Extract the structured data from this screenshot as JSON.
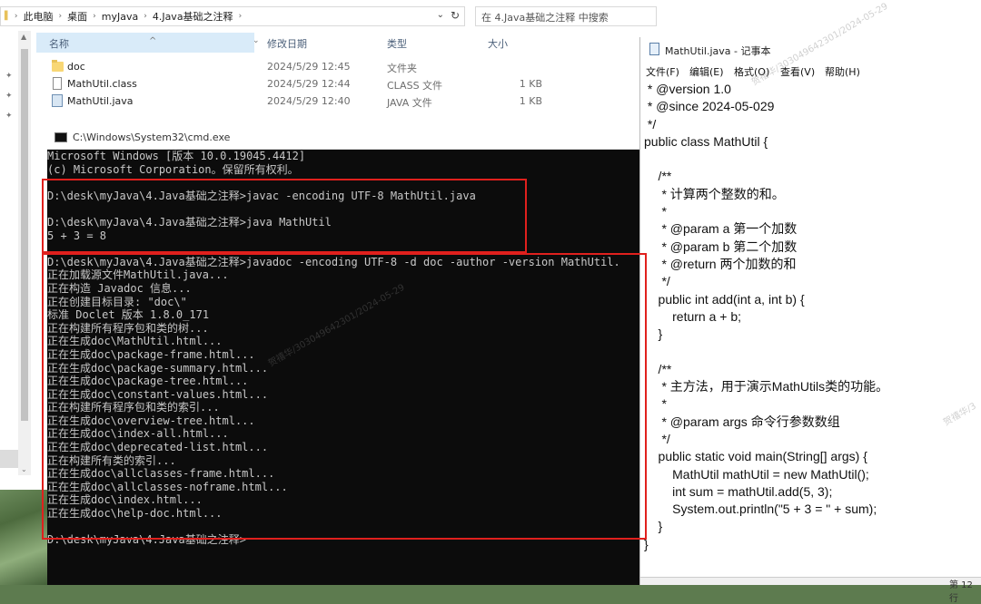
{
  "explorer": {
    "breadcrumbs": [
      "此电脑",
      "桌面",
      "myJava",
      "4.Java基础之注释"
    ],
    "search_placeholder": "在 4.Java基础之注释 中搜索",
    "columns": {
      "name": "名称",
      "modified": "修改日期",
      "type": "类型",
      "size": "大小"
    },
    "files": [
      {
        "name": "doc",
        "modified": "2024/5/29 12:45",
        "type": "文件夹",
        "size": "",
        "icon": "folder-icon"
      },
      {
        "name": "MathUtil.class",
        "modified": "2024/5/29 12:44",
        "type": "CLASS 文件",
        "size": "1 KB",
        "icon": "file-icon"
      },
      {
        "name": "MathUtil.java",
        "modified": "2024/5/29 12:40",
        "type": "JAVA 文件",
        "size": "1 KB",
        "icon": "java-file-icon"
      }
    ]
  },
  "cmd": {
    "title": "C:\\Windows\\System32\\cmd.exe",
    "lines": [
      "Microsoft Windows [版本 10.0.19045.4412]",
      "(c) Microsoft Corporation。保留所有权利。",
      "",
      "D:\\desk\\myJava\\4.Java基础之注释>javac -encoding UTF-8 MathUtil.java",
      "",
      "D:\\desk\\myJava\\4.Java基础之注释>java MathUtil",
      "5 + 3 = 8",
      "",
      "D:\\desk\\myJava\\4.Java基础之注释>javadoc -encoding UTF-8 -d doc -author -version MathUtil.",
      "正在加载源文件MathUtil.java...",
      "正在构造 Javadoc 信息...",
      "正在创建目标目录: \"doc\\\"",
      "标准 Doclet 版本 1.8.0_171",
      "正在构建所有程序包和类的树...",
      "正在生成doc\\MathUtil.html...",
      "正在生成doc\\package-frame.html...",
      "正在生成doc\\package-summary.html...",
      "正在生成doc\\package-tree.html...",
      "正在生成doc\\constant-values.html...",
      "正在构建所有程序包和类的索引...",
      "正在生成doc\\overview-tree.html...",
      "正在生成doc\\index-all.html...",
      "正在生成doc\\deprecated-list.html...",
      "正在构建所有类的索引...",
      "正在生成doc\\allclasses-frame.html...",
      "正在生成doc\\allclasses-noframe.html...",
      "正在生成doc\\index.html...",
      "正在生成doc\\help-doc.html...",
      "",
      "D:\\desk\\myJava\\4.Java基础之注释>"
    ]
  },
  "notepad": {
    "title": "MathUtil.java - 记事本",
    "menu": [
      "文件(F)",
      "编辑(E)",
      "格式(O)",
      "查看(V)",
      "帮助(H)"
    ],
    "lines": [
      " * @version 1.0",
      " * @since 2024-05-029",
      " */",
      "public class MathUtil {",
      "",
      "    /**",
      "     * 计算两个整数的和。",
      "     *",
      "     * @param a 第一个加数",
      "     * @param b 第二个加数",
      "     * @return 两个加数的和",
      "     */",
      "    public int add(int a, int b) {",
      "        return a + b;",
      "    }",
      "",
      "    /**",
      "     * 主方法，用于演示MathUtils类的功能。",
      "     *",
      "     * @param args 命令行参数数组",
      "     */",
      "    public static void main(String[] args) {",
      "        MathUtil mathUtil = new MathUtil();",
      "        int sum = mathUtil.add(5, 3);",
      "        System.out.println(\"5 + 3 = \" + sum);",
      "    }",
      "}"
    ],
    "status": "第 12 行"
  },
  "watermarks": [
    "贺禧华/303049642301/2024-05-29",
    "贺禧华/303049642301/2024-05-29",
    "贺禧华/3"
  ]
}
